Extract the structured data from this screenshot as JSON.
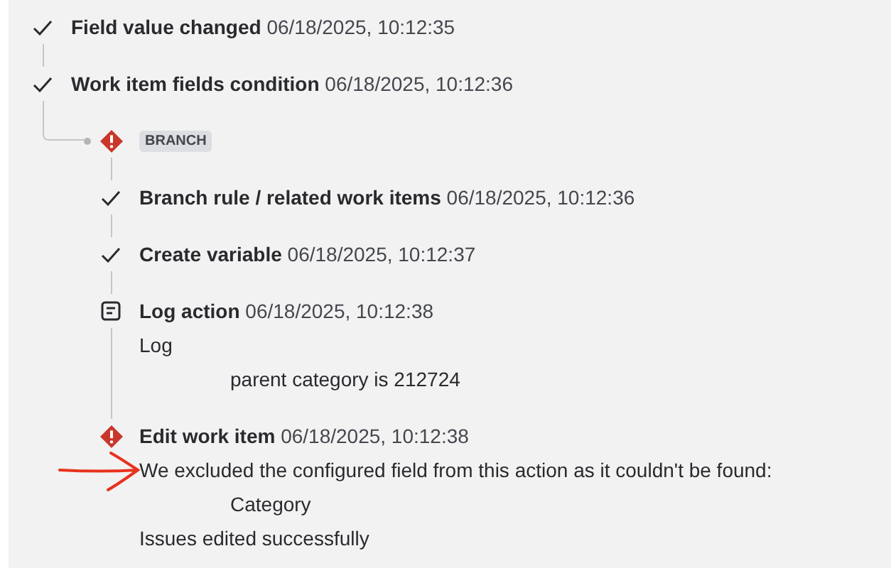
{
  "steps": [
    {
      "kind": "done",
      "title": "Field value changed",
      "time": "06/18/2025, 10:12:35"
    },
    {
      "kind": "done",
      "title": "Work item fields condition",
      "time": "06/18/2025, 10:12:36"
    }
  ],
  "branch": {
    "kind": "error",
    "label": "BRANCH",
    "steps": [
      {
        "kind": "done",
        "title": "Branch rule / related work items",
        "time": "06/18/2025, 10:12:36"
      },
      {
        "kind": "done",
        "title": "Create variable",
        "time": "06/18/2025, 10:12:37"
      },
      {
        "kind": "log",
        "title": "Log action",
        "time": "06/18/2025, 10:12:38",
        "details": [
          {
            "kind": "line",
            "text": "Log"
          },
          {
            "kind": "value",
            "text": "parent category is 212724"
          }
        ]
      },
      {
        "kind": "error",
        "title": "Edit work item",
        "time": "06/18/2025, 10:12:38",
        "annotated": true,
        "details": [
          {
            "kind": "line",
            "text": "We excluded the configured field from this action as it couldn't be found:"
          },
          {
            "kind": "value",
            "text": "Category"
          },
          {
            "kind": "line",
            "text": "Issues edited successfully"
          }
        ]
      }
    ]
  }
}
